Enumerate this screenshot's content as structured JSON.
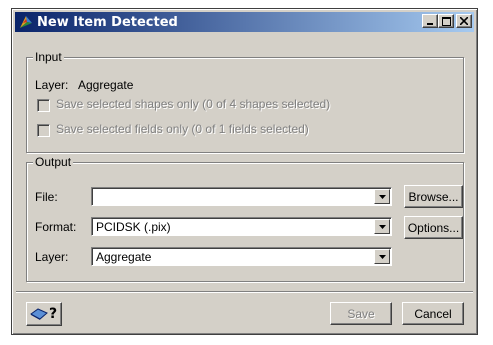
{
  "window": {
    "title": "New Item Detected",
    "title_icon": "geomatica-icon",
    "controls": [
      "minimize",
      "maximize",
      "close"
    ]
  },
  "input_group": {
    "legend": "Input",
    "layer_label": "Layer:",
    "layer_value": "Aggregate",
    "checkbox_shapes": {
      "label": "Save selected shapes only (0 of 4 shapes selected)",
      "checked": false,
      "enabled": false
    },
    "checkbox_fields": {
      "label": "Save selected fields only (0 of 1 fields selected)",
      "checked": false,
      "enabled": false
    }
  },
  "output_group": {
    "legend": "Output",
    "file_label": "File:",
    "file_value": "",
    "browse_label": "Browse...",
    "format_label": "Format:",
    "format_value": "PCIDSK (.pix)",
    "options_label": "Options...",
    "layer_label": "Layer:",
    "layer_value": "Aggregate"
  },
  "footer": {
    "help_icon": "help-book-icon",
    "help_text": "?",
    "save_label": "Save",
    "save_enabled": false,
    "cancel_label": "Cancel"
  }
}
